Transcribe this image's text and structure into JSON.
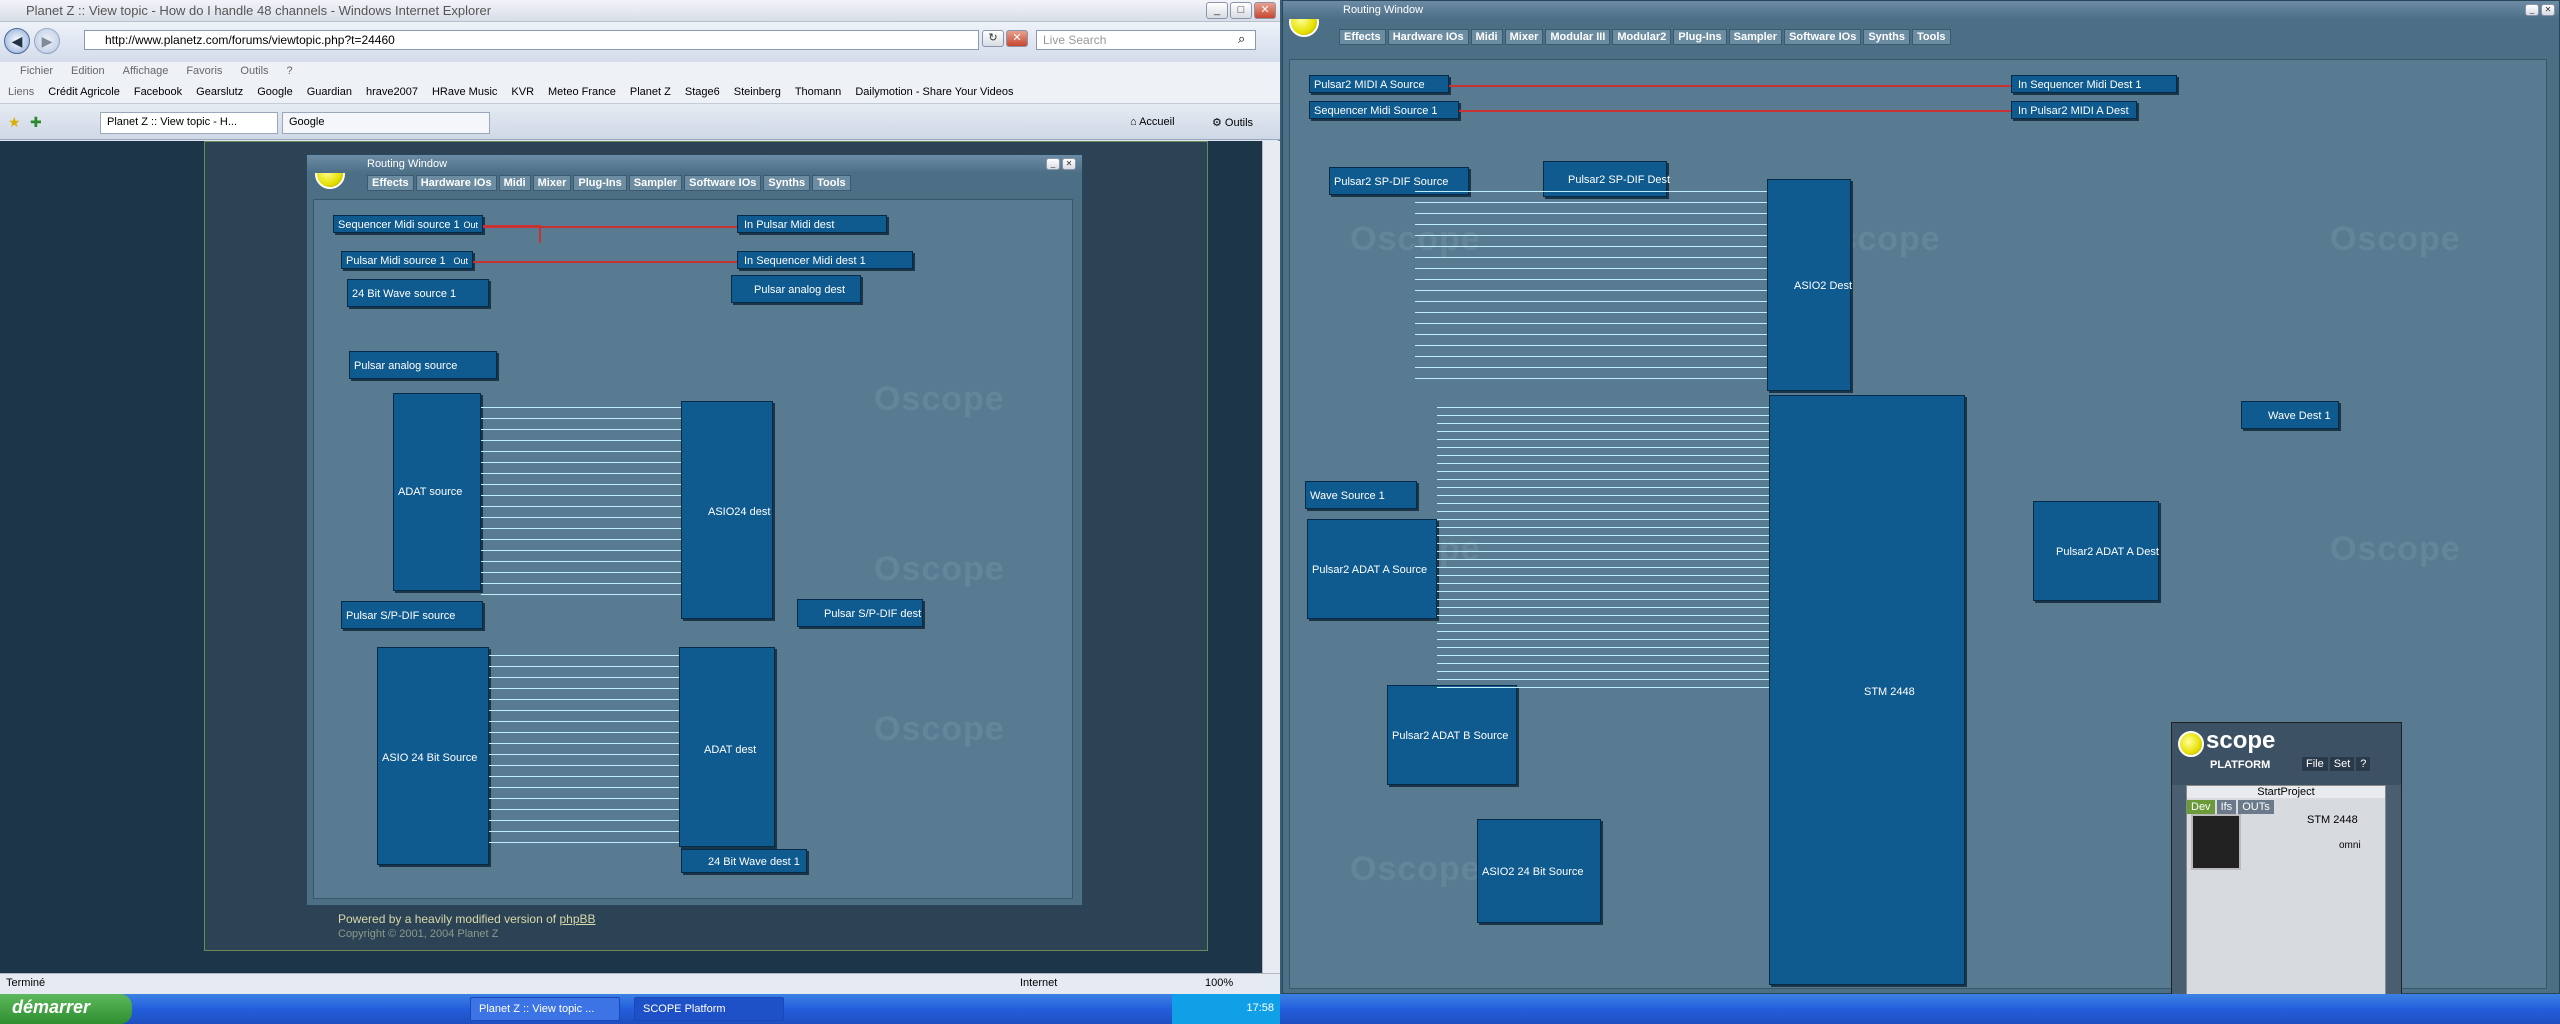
{
  "ie": {
    "title": "Planet Z :: View topic - How do I handle 48 channels - Windows Internet Explorer",
    "url": "http://www.planetz.com/forums/viewtopic.php?t=24460",
    "search_placeholder": "Live Search",
    "menu": [
      "Fichier",
      "Edition",
      "Affichage",
      "Favoris",
      "Outils",
      "?"
    ],
    "fav_label": "Liens",
    "favorites": [
      "Crédit Agricole",
      "Facebook",
      "Gearslutz",
      "Google",
      "Guardian",
      "hrave2007",
      "HRave Music",
      "KVR",
      "Meteo France",
      "Planet Z",
      "Stage6",
      "Steinberg",
      "Thomann",
      "Dailymotion - Share Your Videos"
    ],
    "tabs": [
      "Planet Z :: View topic - H...",
      "Google"
    ],
    "accueil": "Accueil",
    "outils": "Outils",
    "status": "Terminé",
    "zone": "Internet",
    "zoom": "100%",
    "footer": "Powered by a heavily modified version of",
    "footer_link": "phpBB",
    "footer2": "Copyright © 2001, 2004 Planet Z"
  },
  "rw_left": {
    "title": "Routing Window",
    "menu": [
      "Effects",
      "Hardware IOs",
      "Midi",
      "Mixer",
      "Plug-Ins",
      "Sampler",
      "Software IOs",
      "Synths",
      "Tools"
    ],
    "modules": {
      "seq_src": "Sequencer Midi source 1",
      "seq_out": "Out",
      "pulsar_midi_src": "Pulsar Midi source 1",
      "pulsar_midi_out": "Out",
      "in_pulsar_midi": "In Pulsar Midi dest",
      "in_seq_midi": "In Sequencer Midi dest 1",
      "wave_src": "24 Bit Wave source 1",
      "analog_dest": "Pulsar analog dest",
      "analog_src": "Pulsar analog source",
      "adat_src": "ADAT source",
      "asio24_dest": "ASIO24 dest",
      "spdif_src": "Pulsar S/P-DIF source",
      "spdif_dest": "Pulsar S/P-DIF dest",
      "asio24_src": "ASIO 24 Bit Source",
      "adat_dest": "ADAT dest",
      "wave_dest": "24 Bit Wave dest 1"
    }
  },
  "rw_right": {
    "title": "Routing Window",
    "menu": [
      "Effects",
      "Hardware IOs",
      "Midi",
      "Mixer",
      "Modular III",
      "Modular2",
      "Plug-Ins",
      "Sampler",
      "Software IOs",
      "Synths",
      "Tools"
    ],
    "modules": {
      "midi_a_src": "Pulsar2 MIDI A Source",
      "seq_src": "Sequencer Midi Source 1",
      "in_seq_midi": "In Sequencer Midi Dest 1",
      "in_midi_a": "In Pulsar2 MIDI A Dest",
      "spdif_src": "Pulsar2 SP-DIF Source",
      "spdif_dest": "Pulsar2 SP-DIF Dest",
      "asio2_dest": "ASIO2 Dest",
      "wave_src": "Wave Source 1",
      "wave_dest": "Wave Dest 1",
      "adat_a_src": "Pulsar2 ADAT A Source",
      "adat_b_src": "Pulsar2 ADAT B Source",
      "asio2_src": "ASIO2 24 Bit Source",
      "stm": "STM 2448",
      "adat_a_dest": "Pulsar2 ADAT A Dest"
    }
  },
  "scope": {
    "brand": "scope",
    "sub": "PLATFORM",
    "menu": [
      "File",
      "Set",
      "?"
    ],
    "project": "StartProject",
    "tabs": [
      "Dev",
      "Ifs",
      "OUTs"
    ],
    "device": "STM 2448",
    "omni": "omni"
  },
  "taskbar": {
    "start": "démarrer",
    "tasks": [
      "Planet Z :: View topic ...",
      "SCOPE Platform"
    ],
    "clock": "17:58"
  }
}
